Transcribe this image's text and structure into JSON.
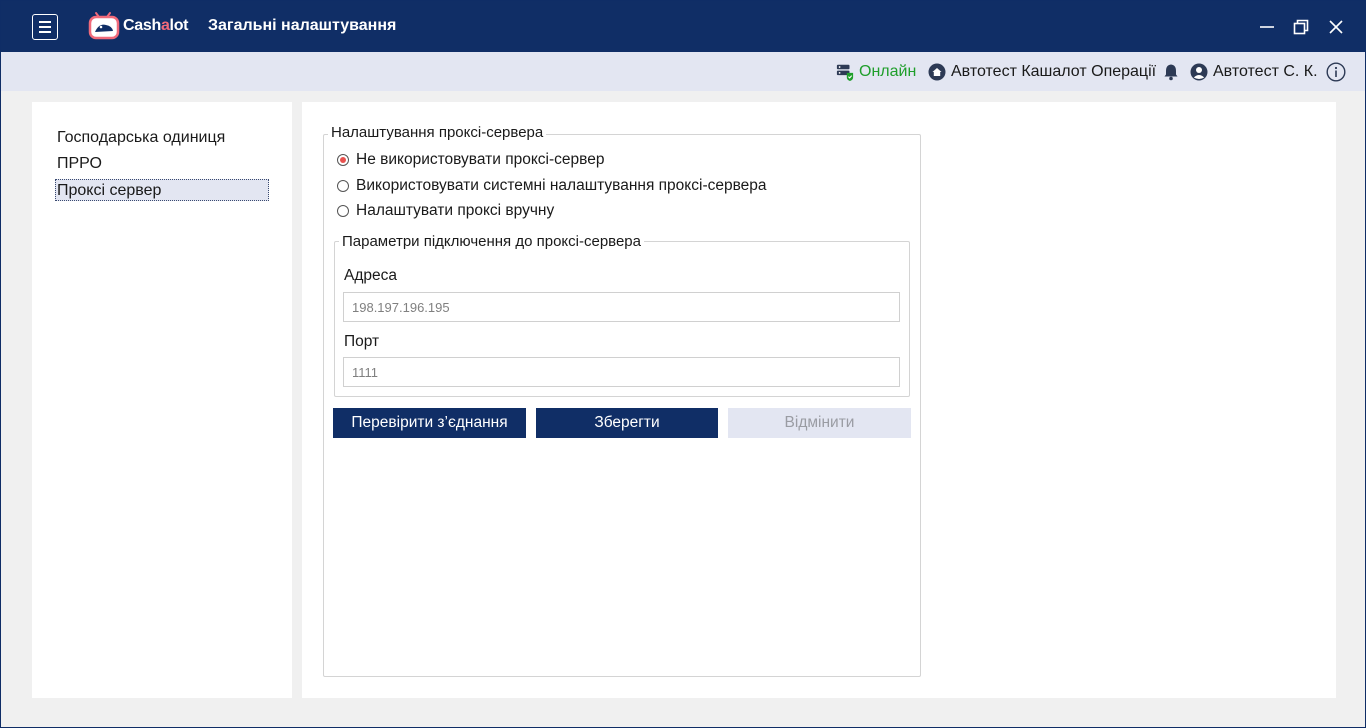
{
  "app": {
    "logo_prefix": "Cash",
    "logo_accent": "a",
    "logo_suffix": "lot",
    "title": "Загальні налаштування"
  },
  "status": {
    "online": "Онлайн",
    "org": "Автотест Кашалот Операції",
    "user": "Автотест С. К."
  },
  "nav": {
    "items": [
      {
        "label": "Господарська одиниця"
      },
      {
        "label": "ПРРО"
      },
      {
        "label": "Проксі сервер"
      }
    ],
    "selected": "Проксі сервер"
  },
  "proxy": {
    "group_title": "Налаштування проксі-сервера",
    "options": [
      {
        "label": "Не використовувати проксі-сервер",
        "checked": true
      },
      {
        "label": "Використовувати системні налаштування проксі-сервера",
        "checked": false
      },
      {
        "label": "Налаштувати проксі вручну",
        "checked": false
      }
    ],
    "params_title": "Параметри підключення до проксі-сервера",
    "address_label": "Адреса",
    "address_value": "198.197.196.195",
    "port_label": "Порт",
    "port_value": "1111"
  },
  "buttons": {
    "test": "Перевірити з’єднання",
    "save": "Зберегти",
    "cancel": "Відмінити"
  },
  "colors": {
    "titlebar": "#102e66",
    "statusbar": "#e3e6f2",
    "online": "#1f9e2b",
    "radio_checked": "#e8524f",
    "logo_accent": "#f06a7a"
  }
}
